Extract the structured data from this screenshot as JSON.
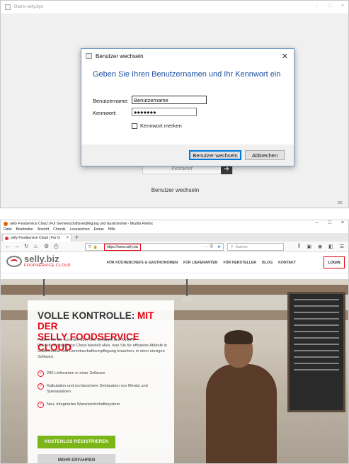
{
  "login_app": {
    "window_title": "Sfams-selly.bye",
    "dialog": {
      "title": "Benutzer wechseln",
      "heading": "Geben Sie Ihren Benutzernamen und Ihr Kennwort ein",
      "username_label": "Benutzername:",
      "username_value": "Benutzername",
      "password_label": "Kennwort:",
      "password_value": "●●●●●●●",
      "remember_label": "Kennwort merken",
      "remember_checked": false,
      "ok_button": "Benutzer wechseln",
      "cancel_button": "Abbrechen"
    },
    "behind": {
      "password_placeholder": "Kennwort",
      "switch_user_label": "Benutzer wechseln",
      "language": "DE"
    }
  },
  "browser": {
    "window_title": "selly Foodservice Cloud | Für Gemeinschaftsverpflegung und Gastronomie - Mozilla Firefox",
    "menu": [
      "Datei",
      "Bearbeiten",
      "Ansicht",
      "Chronik",
      "Lesezeichen",
      "Extras",
      "Hilfe"
    ],
    "tab_title": "selly Foodservice Cloud | Für G",
    "url": "https://www.selly.biz",
    "search_placeholder": "Suchen"
  },
  "site": {
    "brand": "selly.biz",
    "brand_sub": "FOODSERVICE CLOUD",
    "nav": [
      "FÜR KÜCHENCHEFS & GASTRONOMEN",
      "FÜR LIEFERANTEN",
      "FÜR HERSTELLER",
      "BLOG",
      "KONTAKT"
    ],
    "login": "LOGIN",
    "hero": {
      "title_main": "VOLLE KONTROLLE: ",
      "title_red_1": "MIT DER",
      "title_line2": "SELLY FOODSERVICE CLOUD",
      "lead_1": "Haben Sie die Kontrolle über Ihre Einkäufe und Kosten?",
      "lead_2": "Die selly Foodservice Cloud bündelt alles, was Sie für effiziente Abläufe in Gastronomie und Gemeinschaftsverpflegung brauchen, in einer einzigen Software.",
      "features": [
        "200 Lieferanten in einer Software",
        "Kalkulation und rechtssichere Deklaration von Menüs und Speiseplänen",
        "Neu: Integriertes Warenwirtschaftssystem"
      ],
      "cta": "KOSTENLOS REGISTRIEREN",
      "more": "MEHR ERFAHREN"
    }
  },
  "colors": {
    "accent_red": "#e30613",
    "cta_green": "#7cb518",
    "dialog_heading": "#1a4fa0"
  }
}
